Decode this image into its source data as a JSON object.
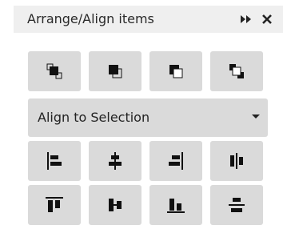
{
  "panel": {
    "title": "Arrange/Align items",
    "collapse_icon": "double-chevron-right-icon",
    "close_icon": "close-icon"
  },
  "arrange_buttons": [
    {
      "icon": "bring-to-front-icon"
    },
    {
      "icon": "bring-forward-icon"
    },
    {
      "icon": "send-backward-icon"
    },
    {
      "icon": "send-to-back-icon"
    }
  ],
  "align_mode": {
    "selected": "Align to Selection"
  },
  "align_buttons_row1": [
    {
      "icon": "align-left-icon"
    },
    {
      "icon": "align-horizontal-center-icon"
    },
    {
      "icon": "align-right-icon"
    },
    {
      "icon": "distribute-horizontal-icon"
    }
  ],
  "align_buttons_row2": [
    {
      "icon": "align-top-icon"
    },
    {
      "icon": "align-vertical-center-icon"
    },
    {
      "icon": "align-bottom-icon"
    },
    {
      "icon": "distribute-vertical-icon"
    }
  ],
  "colors": {
    "title_bar": "#efefef",
    "button_face": "#dadada",
    "icon": "#111111"
  }
}
